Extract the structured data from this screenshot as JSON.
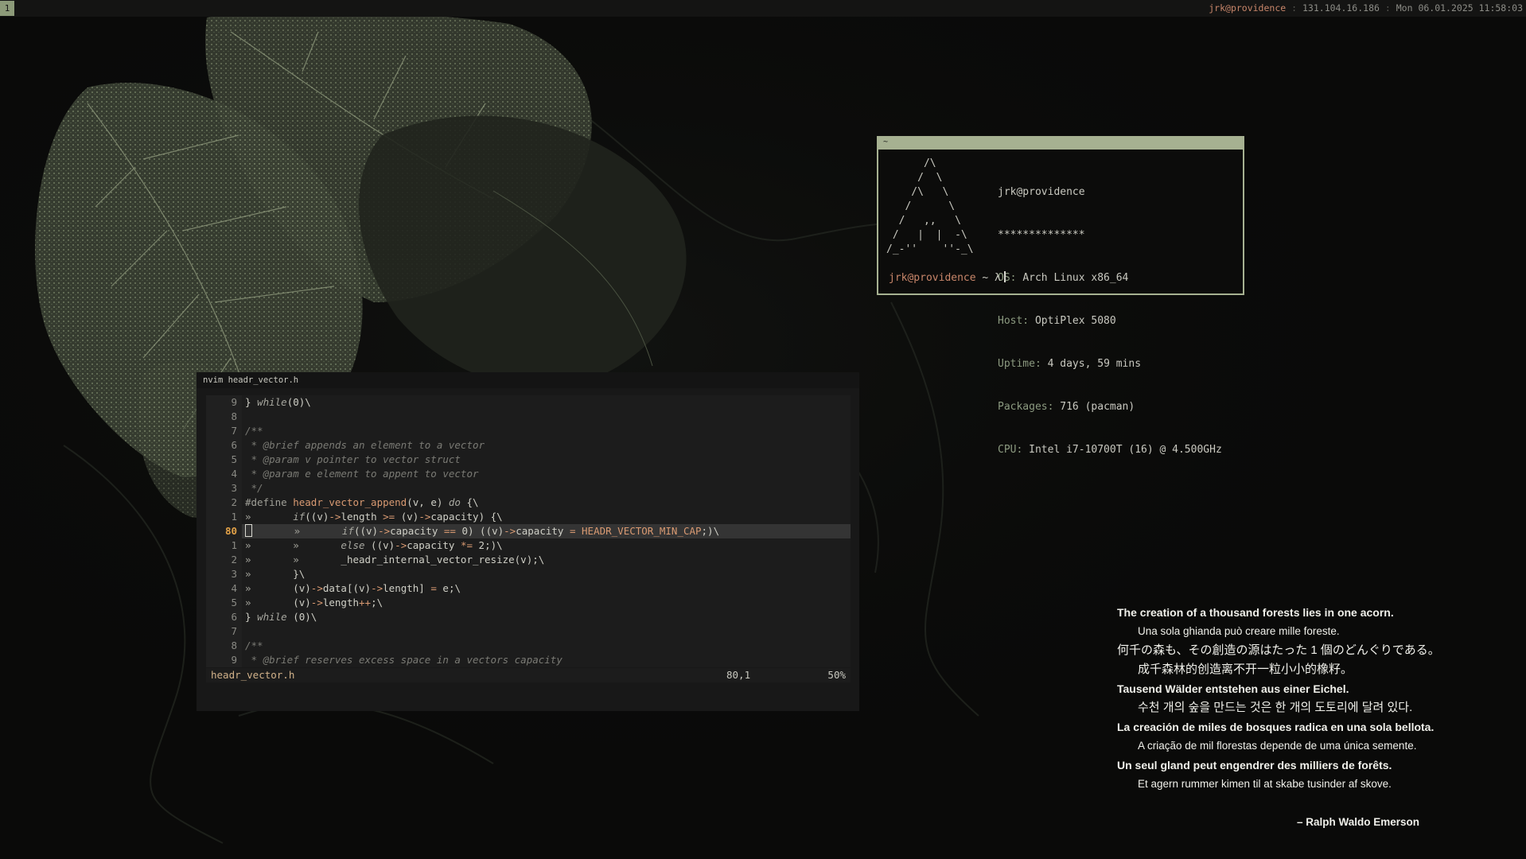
{
  "topbar": {
    "workspace": "1",
    "user_host": "jrk@providence",
    "ip": "131.104.16.186",
    "datetime": "Mon 06.01.2025 11:58:03",
    "separator": ":"
  },
  "terminal": {
    "title": "~",
    "ascii_art": "      /\\\n     /  \\\n    /\\   \\\n   /      \\\n  /   ,,   \\\n /   |  |  -\\\n/_-''    ''-_\\",
    "neofetch": {
      "user_host": "jrk@providence",
      "underline": "**************",
      "rows": [
        {
          "label": "OS:",
          "value": "Arch Linux x86_64"
        },
        {
          "label": "Host:",
          "value": "OptiPlex 5080"
        },
        {
          "label": "Uptime:",
          "value": "4 days, 59 mins"
        },
        {
          "label": "Packages:",
          "value": "716 (pacman)"
        },
        {
          "label": "CPU:",
          "value": "Intel i7-10700T (16) @ 4.500GHz"
        }
      ]
    },
    "prompt": {
      "host": "jrk@providence",
      "rest": " ~ λ"
    }
  },
  "nvim": {
    "title": "nvim headr_vector.h",
    "statusline": {
      "filename": "headr_vector.h",
      "position": "80,1",
      "percent": "50%"
    },
    "lines": [
      {
        "n": "9",
        "text": "} while(0)\\"
      },
      {
        "n": "8",
        "text": ""
      },
      {
        "n": "7",
        "text": "/**"
      },
      {
        "n": "6",
        "text": " * @brief appends an element to a vector"
      },
      {
        "n": "5",
        "text": " * @param v pointer to vector struct"
      },
      {
        "n": "4",
        "text": " * @param e element to appent to vector"
      },
      {
        "n": "3",
        "text": " */"
      },
      {
        "n": "2",
        "text": "#define headr_vector_append(v, e) do {\\"
      },
      {
        "n": "1",
        "text": "»       if((v)->length >= (v)->capacity) {\\"
      },
      {
        "n": "80",
        "text": "»       »       if((v)->capacity == 0) ((v)->capacity = HEADR_VECTOR_MIN_CAP;)\\"
      },
      {
        "n": "1",
        "text": "»       »       else ((v)->capacity *= 2;)\\"
      },
      {
        "n": "2",
        "text": "»       »       _headr_internal_vector_resize(v);\\"
      },
      {
        "n": "3",
        "text": "»       }\\"
      },
      {
        "n": "4",
        "text": "»       (v)->data[(v)->length] = e;\\"
      },
      {
        "n": "5",
        "text": "»       (v)->length++;\\"
      },
      {
        "n": "6",
        "text": "} while (0)\\"
      },
      {
        "n": "7",
        "text": ""
      },
      {
        "n": "8",
        "text": "/**"
      },
      {
        "n": "9",
        "text": " * @brief reserves excess space in a vectors capacity"
      }
    ]
  },
  "quote": {
    "lines": [
      "The creation of a thousand forests lies in one acorn.",
      "Una sola ghianda può creare mille foreste.",
      "何千の森も、その創造の源はたった 1 個のどんぐりである。",
      "成千森林的创造离不开一粒小小的橡籽。",
      "Tausend Wälder entstehen aus einer Eichel.",
      "수천 개의 숲을 만드는 것은 한 개의 도토리에 달려 있다.",
      "La creación de miles de bosques radica en una sola bellota.",
      "A criação de mil florestas depende de uma única semente.",
      "Un seul gland peut engendrer des milliers de forêts.",
      "Et agern rummer kimen til at skabe tusinder af skove."
    ],
    "author": "– Ralph Waldo Emerson"
  },
  "colors": {
    "accent": "#a6b191",
    "orange": "#c8866a",
    "line_number_current": "#e3a248"
  }
}
